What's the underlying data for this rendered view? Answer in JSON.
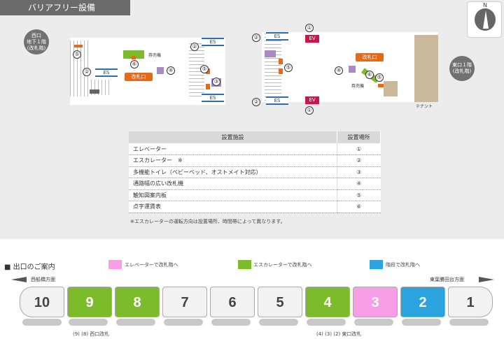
{
  "header": {
    "title": "バリアフリー設備"
  },
  "compass": {
    "label": "N"
  },
  "exits": {
    "west": "西口\n地下１階\n(改札階)",
    "east": "東口１階\n(改札階)"
  },
  "map": {
    "es_label": "ES",
    "ev_label": "EV",
    "gate_label": "改札口",
    "ticket_machine": "券売機",
    "tenant": "テナント",
    "markers": [
      "①",
      "②",
      "③",
      "④",
      "⑤",
      "⑥"
    ]
  },
  "facilities": {
    "headers": [
      "設置施設",
      "設置場所"
    ],
    "rows": [
      {
        "name": "エレベーター",
        "place": "①"
      },
      {
        "name": "エスカレーター　※",
        "place": "②"
      },
      {
        "name": "多機能トイレ（ベビーベッド、オストメイト対応）",
        "place": "③"
      },
      {
        "name": "通路幅の広い改札機",
        "place": "④"
      },
      {
        "name": "触知図案内板",
        "place": "⑤"
      },
      {
        "name": "点字運賃表",
        "place": "⑥"
      }
    ],
    "note": "※エスカレーターの運転方向は設置場所、時間帯によって異なります。"
  },
  "guide": {
    "title": "■ 出口のご案内",
    "legend": [
      {
        "label": "エレベーターで改札階へ",
        "color": "#f79ee6"
      },
      {
        "label": "エスカレーターで改札階へ",
        "color": "#7cbc2b"
      },
      {
        "label": "階段で改札階へ",
        "color": "#2ba3df"
      }
    ],
    "left_direction": "西船橋方面",
    "right_direction": "東葉勝田台方面",
    "cars": [
      {
        "number": "10",
        "color": "#f2f2f2"
      },
      {
        "number": "9",
        "color": "#7cbc2b"
      },
      {
        "number": "8",
        "color": "#7cbc2b"
      },
      {
        "number": "7",
        "color": "#f2f2f2"
      },
      {
        "number": "6",
        "color": "#f2f2f2"
      },
      {
        "number": "5",
        "color": "#f2f2f2"
      },
      {
        "number": "4",
        "color": "#7cbc2b"
      },
      {
        "number": "3",
        "color": "#f79ee6"
      },
      {
        "number": "2",
        "color": "#2ba3df"
      },
      {
        "number": "1",
        "color": "#f2f2f2"
      }
    ],
    "west_gate_label": "(9) (8) 西口改札",
    "east_gate_label": "(4) (3) (2) 東口改札"
  }
}
